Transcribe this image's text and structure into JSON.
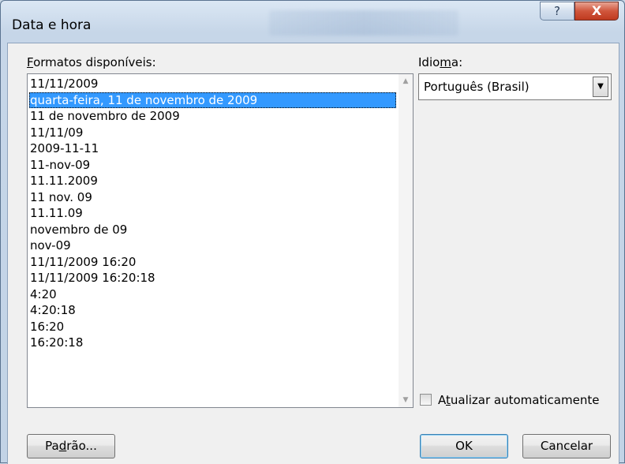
{
  "window": {
    "title": "Data e hora",
    "help_glyph": "?",
    "close_glyph": "X"
  },
  "formats": {
    "label_before": "",
    "label_accel": "F",
    "label_after": "ormatos disponíveis:",
    "items": [
      "11/11/2009",
      "quarta-feira, 11 de novembro de 2009",
      "11 de novembro de 2009",
      "11/11/09",
      "2009-11-11",
      "11-nov-09",
      "11.11.2009",
      "11 nov. 09",
      "11.11.09",
      "novembro de 09",
      "nov-09",
      "11/11/2009 16:20",
      "11/11/2009 16:20:18",
      "4:20",
      "4:20:18",
      "16:20",
      "16:20:18"
    ],
    "selected_index": 1
  },
  "language": {
    "label_before": "Idio",
    "label_accel": "m",
    "label_after": "a:",
    "value": "Português (Brasil)"
  },
  "auto_update": {
    "label_before": "A",
    "label_accel": "t",
    "label_after": "ualizar automaticamente",
    "checked": false
  },
  "buttons": {
    "default_before": "Pa",
    "default_accel": "d",
    "default_after": "rão...",
    "ok": "OK",
    "cancel": "Cancelar"
  },
  "icons": {
    "scroll_up": "scroll-up-arrow-icon",
    "scroll_down": "scroll-down-arrow-icon",
    "dropdown": "chevron-down-icon",
    "help": "question-icon",
    "close": "close-icon"
  }
}
